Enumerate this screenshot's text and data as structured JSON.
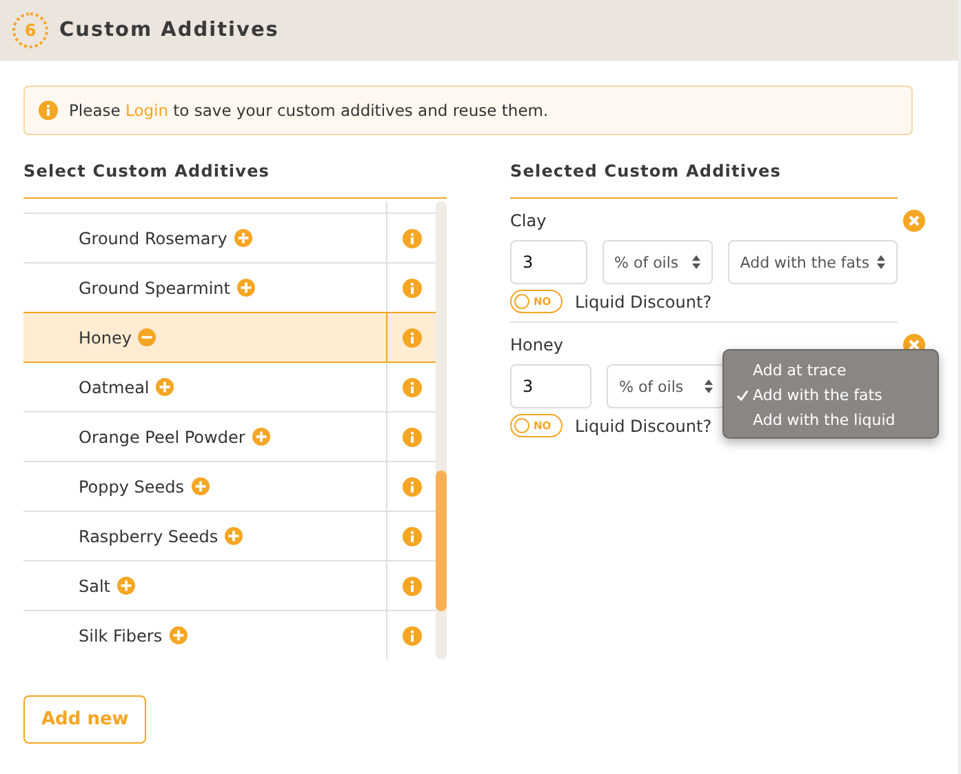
{
  "section": {
    "number": "6",
    "title": "Custom Additives"
  },
  "notice": {
    "before": "Please ",
    "link": "Login",
    "after": " to save your custom additives and reuse them."
  },
  "list_title": "Select Custom Additives",
  "additives": [
    {
      "name": "Ground Rosemary",
      "selected": false
    },
    {
      "name": "Ground Spearmint",
      "selected": false
    },
    {
      "name": "Honey",
      "selected": true
    },
    {
      "name": "Oatmeal",
      "selected": false
    },
    {
      "name": "Orange Peel Powder",
      "selected": false
    },
    {
      "name": "Poppy Seeds",
      "selected": false
    },
    {
      "name": "Raspberry Seeds",
      "selected": false
    },
    {
      "name": "Salt",
      "selected": false
    },
    {
      "name": "Silk Fibers",
      "selected": false
    }
  ],
  "add_button": "Add new",
  "selected_title": "Selected Custom Additives",
  "selected": [
    {
      "name": "Clay",
      "amount": "3",
      "unit": "% of oils",
      "stage": "Add with the fats",
      "toggle": {
        "label": "NO",
        "on": false
      },
      "discount_label": "Liquid Discount?"
    },
    {
      "name": "Honey",
      "amount": "3",
      "unit": "% of oils",
      "toggle": {
        "label": "NO",
        "on": false
      },
      "discount_label": "Liquid Discount?",
      "menu": [
        {
          "label": "Add at trace",
          "selected": false
        },
        {
          "label": "Add with the fats",
          "selected": true
        },
        {
          "label": "Add with the liquid",
          "selected": false
        }
      ]
    }
  ]
}
